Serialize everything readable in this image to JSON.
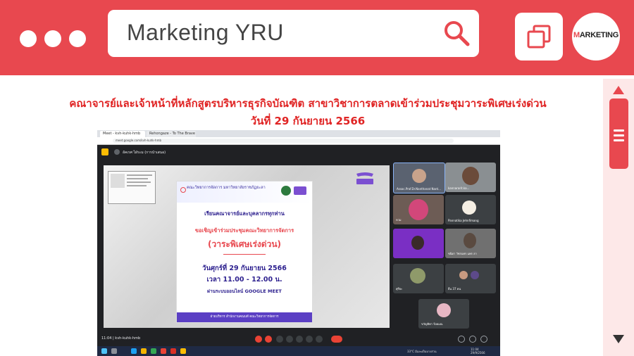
{
  "header": {
    "search_text": "Marketing YRU",
    "logo_text_m": "M",
    "logo_text_rest": "ARKETING"
  },
  "article": {
    "title_line1": "คณาจารย์และเจ้าหน้าที่หลักสูตรบริหารธุรกิจบัณฑิต สาขาวิชาการตลาดเข้าร่วมประชุมวาระพิเศษเร่งด่วน",
    "title_line2": "วันที่ 29 กันยายน 2566"
  },
  "screenshot": {
    "tab1": "Meet - kvh-kuhk-hmb",
    "tab2": "Rehongaze - To The Brave",
    "url": "meet.google.com/kvh-kuhk-hmb",
    "presenter_label": "อัคเรศ ไฝ่ระม (การนำเสนอ)",
    "poster": {
      "header": "คณะวิทยาการจัดการ มหาวิทยาลัยราชภัฏยะลา",
      "line1": "เรียนคณาจารย์และบุคลากรทุกท่าน",
      "line2": "ขอเชิญเข้าร่วมประชุมคณะวิทยาการจัดการ",
      "line3": "(วาระพิเศษเร่งด่วน)",
      "line4": "วันศุกร์ที่ 29 กันยายน 2566",
      "line5": "เวลา 11.00 - 12.00 น.",
      "line6": "ผ่านระบบออนไลน์ GOOGLE MEET",
      "footer": "ฝ่ายบริหาร สำนักงานคณบดี คณะวิทยาการจัดการ"
    },
    "participants": [
      {
        "name": "Assoc.Prof.Dr.Nanthanat Nant..."
      },
      {
        "name": "kannararit.ka..."
      },
      {
        "name": "หวม"
      },
      {
        "name": "Pannatika Jehnfimang"
      },
      {
        "name": ""
      },
      {
        "name": "ชนิดา วัชรนทร แพร ลา"
      },
      {
        "name": "ศุรียะ"
      },
      {
        "name": "อื่น 37 คน"
      },
      {
        "name": "ขวัญทิพา ร้อยมณ"
      }
    ],
    "meeting_time": "11:04",
    "meeting_code": "kvh-kuhk-hmb",
    "weather": "33°C มีเมฆเป็นบางส่วน",
    "clock_time": "11:04",
    "clock_date": "29/9/2566"
  }
}
